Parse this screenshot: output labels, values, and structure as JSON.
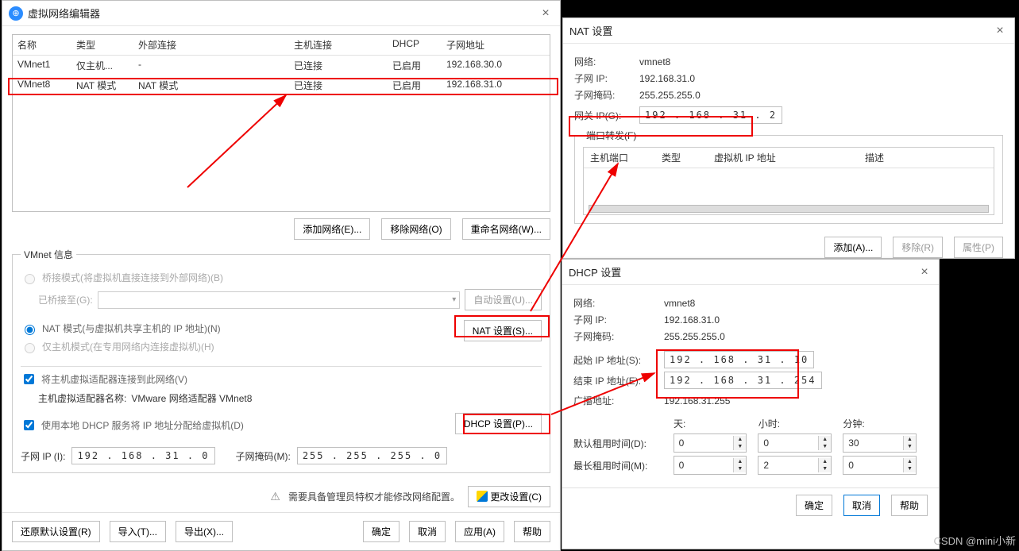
{
  "vne": {
    "title": "虚拟网络编辑器",
    "columns": {
      "name": "名称",
      "type": "类型",
      "ext": "外部连接",
      "host": "主机连接",
      "dhcp": "DHCP",
      "subnet": "子网地址"
    },
    "rows": [
      {
        "name": "VMnet1",
        "type": "仅主机...",
        "ext": "-",
        "host": "已连接",
        "dhcp": "已启用",
        "subnet": "192.168.30.0"
      },
      {
        "name": "VMnet8",
        "type": "NAT 模式",
        "ext": "NAT 模式",
        "host": "已连接",
        "dhcp": "已启用",
        "subnet": "192.168.31.0"
      }
    ],
    "buttons": {
      "add": "添加网络(E)...",
      "remove": "移除网络(O)",
      "rename": "重命名网络(W)..."
    },
    "info_legend": "VMnet 信息",
    "bridge_label": "桥接模式(将虚拟机直接连接到外部网络)(B)",
    "bridge_to": "已桥接至(G):",
    "auto_set": "自动设置(U)...",
    "nat_label": "NAT 模式(与虚拟机共享主机的 IP 地址)(N)",
    "nat_set": "NAT 设置(S)...",
    "hostonly_label": "仅主机模式(在专用网络内连接虚拟机)(H)",
    "host_adapter_chk": "将主机虚拟适配器连接到此网络(V)",
    "host_adapter_name_label": "主机虚拟适配器名称: ",
    "host_adapter_name_value": "VMware 网络适配器 VMnet8",
    "dhcp_chk": "使用本地 DHCP 服务将 IP 地址分配给虚拟机(D)",
    "dhcp_set": "DHCP 设置(P)...",
    "subnet_ip_lbl": "子网 IP (I):",
    "subnet_ip_val": "192 . 168 . 31 .  0",
    "subnet_mask_lbl": "子网掩码(M):",
    "subnet_mask_val": "255 . 255 . 255 .  0",
    "admin_note": "需要具备管理员特权才能修改网络配置。",
    "change_settings": "更改设置(C)",
    "bottom": {
      "restore": "还原默认设置(R)",
      "import": "导入(T)...",
      "export": "导出(X)...",
      "ok": "确定",
      "cancel": "取消",
      "apply": "应用(A)",
      "help": "帮助"
    }
  },
  "nat": {
    "title": "NAT 设置",
    "network_lbl": "网络:",
    "network_val": "vmnet8",
    "subnet_lbl": "子网 IP:",
    "subnet_val": "192.168.31.0",
    "mask_lbl": "子网掩码:",
    "mask_val": "255.255.255.0",
    "gateway_lbl": "网关 IP(G):",
    "gateway_val": "192 . 168 . 31 .  2",
    "pf_legend": "端口转发(F)",
    "pf_cols": {
      "host": "主机端口",
      "type": "类型",
      "vmip": "虚拟机 IP 地址",
      "desc": "描述"
    },
    "pf_btns": {
      "add": "添加(A)...",
      "remove": "移除(R)",
      "prop": "属性(P)"
    }
  },
  "dhcp": {
    "title": "DHCP 设置",
    "network_lbl": "网络:",
    "network_val": "vmnet8",
    "subnet_lbl": "子网 IP:",
    "subnet_val": "192.168.31.0",
    "mask_lbl": "子网掩码:",
    "mask_val": "255.255.255.0",
    "start_lbl": "起始 IP 地址(S):",
    "start_val": "192 . 168 . 31 . 10",
    "end_lbl": "结束 IP 地址(E):",
    "end_val": "192 . 168 . 31 . 254",
    "bcast_lbl": "广播地址:",
    "bcast_val": "192.168.31.255",
    "lease_head": {
      "days": "天:",
      "hours": "小时:",
      "mins": "分钟:"
    },
    "default_lease_lbl": "默认租用时间(D):",
    "max_lease_lbl": "最长租用时间(M):",
    "default_lease": {
      "d": "0",
      "h": "0",
      "m": "30"
    },
    "max_lease": {
      "d": "0",
      "h": "2",
      "m": "0"
    },
    "btns": {
      "ok": "确定",
      "cancel": "取消",
      "help": "帮助"
    }
  },
  "watermark": "CSDN @mini小新"
}
